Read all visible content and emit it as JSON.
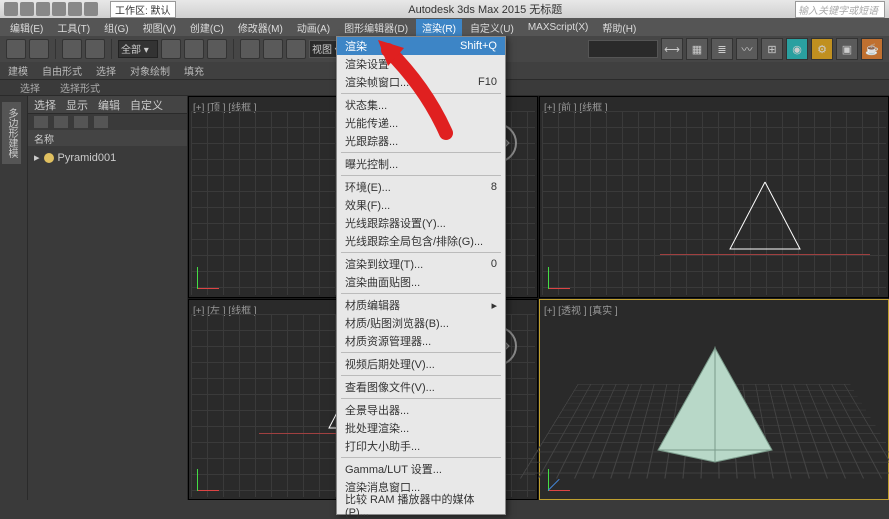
{
  "title": "Autodesk 3ds Max 2015   无标题",
  "workspace": "工作区: 默认",
  "search_ph": "输入关键字或短语",
  "menubar": [
    "编辑(E)",
    "工具(T)",
    "组(G)",
    "视图(V)",
    "创建(C)",
    "修改器(M)",
    "动画(A)",
    "图形编辑器(D)",
    "渲染(R)",
    "自定义(U)",
    "MAXScript(X)",
    "帮助(H)"
  ],
  "ribbon": [
    "建模",
    "自由形式",
    "选择",
    "对象绘制",
    "填充"
  ],
  "sub": [
    "选择",
    "选择形式"
  ],
  "vtab": "多边形建模",
  "panel": {
    "tabs": [
      "选择",
      "显示",
      "编辑",
      "自定义"
    ],
    "name_hdr": "名称",
    "item": "Pyramid001"
  },
  "viewports": {
    "tl": "[+] [顶 ] [线框 ]",
    "tr": "[+] [前 ] [线框 ]",
    "bl": "[+] [左 ] [线框 ]",
    "br": "[+] [透视 ] [真实 ]"
  },
  "render_menu": [
    {
      "t": "渲染",
      "s": "Shift+Q",
      "hl": true
    },
    {
      "t": "渲染设置",
      "s": ""
    },
    {
      "t": "渲染帧窗口...",
      "s": "F10"
    },
    {
      "sep": true
    },
    {
      "t": "状态集...",
      "s": ""
    },
    {
      "t": "光能传递...",
      "s": ""
    },
    {
      "t": "光跟踪器...",
      "s": ""
    },
    {
      "sep": true
    },
    {
      "t": "曝光控制...",
      "s": ""
    },
    {
      "sep": true
    },
    {
      "t": "环境(E)...",
      "s": "8"
    },
    {
      "t": "效果(F)...",
      "s": ""
    },
    {
      "t": "光线跟踪器设置(Y)...",
      "s": ""
    },
    {
      "t": "光线跟踪全局包含/排除(G)...",
      "s": ""
    },
    {
      "sep": true
    },
    {
      "t": "渲染到纹理(T)...",
      "s": "0"
    },
    {
      "t": "渲染曲面贴图...",
      "s": ""
    },
    {
      "sep": true
    },
    {
      "t": "材质编辑器",
      "s": "▸"
    },
    {
      "t": "材质/贴图浏览器(B)...",
      "s": ""
    },
    {
      "t": "材质资源管理器...",
      "s": ""
    },
    {
      "sep": true
    },
    {
      "t": "视频后期处理(V)...",
      "s": ""
    },
    {
      "sep": true
    },
    {
      "t": "查看图像文件(V)...",
      "s": ""
    },
    {
      "sep": true
    },
    {
      "t": "全景导出器...",
      "s": ""
    },
    {
      "t": "批处理渲染...",
      "s": ""
    },
    {
      "t": "打印大小助手...",
      "s": ""
    },
    {
      "sep": true
    },
    {
      "t": "Gamma/LUT 设置...",
      "s": ""
    },
    {
      "t": "渲染消息窗口...",
      "s": ""
    },
    {
      "t": "比较 RAM 播放器中的媒体(P)...",
      "s": ""
    }
  ]
}
